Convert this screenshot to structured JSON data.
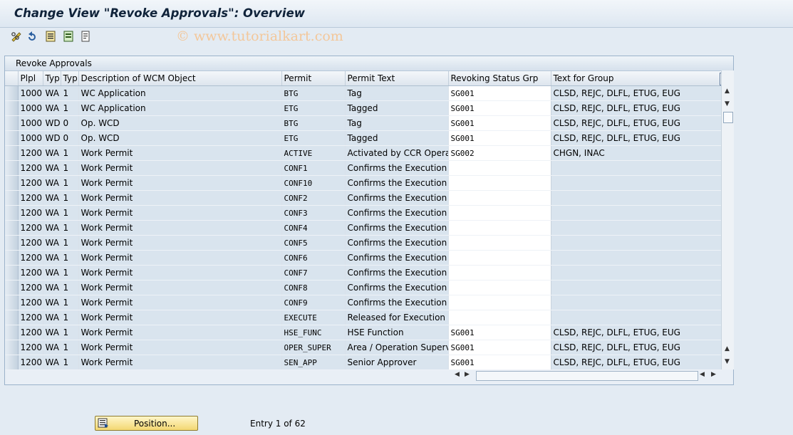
{
  "window": {
    "title": "Change View \"Revoke Approvals\": Overview"
  },
  "toolbar": {
    "icons": [
      "glasses-edit-icon",
      "undo-icon",
      "save-icon",
      "select-all-icon",
      "details-icon"
    ]
  },
  "watermark": "© www.tutorialkart.com",
  "panel": {
    "title": "Revoke Approvals"
  },
  "table": {
    "columns": [
      "Plpl",
      "Typ",
      "Typ",
      "Description of WCM Object",
      "Permit",
      "Permit Text",
      "Revoking Status Grp",
      "Text for Group"
    ],
    "rows": [
      [
        "1000",
        "WA",
        "1",
        "WC Application",
        "BTG",
        "Tag",
        "SG001",
        "CLSD, REJC, DLFL, ETUG, EUG"
      ],
      [
        "1000",
        "WA",
        "1",
        "WC Application",
        "ETG",
        "Tagged",
        "SG001",
        "CLSD, REJC, DLFL, ETUG, EUG"
      ],
      [
        "1000",
        "WD",
        "0",
        "Op. WCD",
        "BTG",
        "Tag",
        "SG001",
        "CLSD, REJC, DLFL, ETUG, EUG"
      ],
      [
        "1000",
        "WD",
        "0",
        "Op. WCD",
        "ETG",
        "Tagged",
        "SG001",
        "CLSD, REJC, DLFL, ETUG, EUG"
      ],
      [
        "1200",
        "WA",
        "1",
        "Work Permit",
        "ACTIVE",
        "Activated by CCR Operat...",
        "SG002",
        "CHGN, INAC"
      ],
      [
        "1200",
        "WA",
        "1",
        "Work Permit",
        "CONF1",
        "Confirms the Execution",
        "",
        ""
      ],
      [
        "1200",
        "WA",
        "1",
        "Work Permit",
        "CONF10",
        "Confirms the Execution",
        "",
        ""
      ],
      [
        "1200",
        "WA",
        "1",
        "Work Permit",
        "CONF2",
        "Confirms the Execution",
        "",
        ""
      ],
      [
        "1200",
        "WA",
        "1",
        "Work Permit",
        "CONF3",
        "Confirms the Execution",
        "",
        ""
      ],
      [
        "1200",
        "WA",
        "1",
        "Work Permit",
        "CONF4",
        "Confirms the Execution",
        "",
        ""
      ],
      [
        "1200",
        "WA",
        "1",
        "Work Permit",
        "CONF5",
        "Confirms the Execution",
        "",
        ""
      ],
      [
        "1200",
        "WA",
        "1",
        "Work Permit",
        "CONF6",
        "Confirms the Execution",
        "",
        ""
      ],
      [
        "1200",
        "WA",
        "1",
        "Work Permit",
        "CONF7",
        "Confirms the Execution",
        "",
        ""
      ],
      [
        "1200",
        "WA",
        "1",
        "Work Permit",
        "CONF8",
        "Confirms the Execution",
        "",
        ""
      ],
      [
        "1200",
        "WA",
        "1",
        "Work Permit",
        "CONF9",
        "Confirms the Execution",
        "",
        ""
      ],
      [
        "1200",
        "WA",
        "1",
        "Work Permit",
        "EXECUTE",
        "Released for Execution",
        "",
        ""
      ],
      [
        "1200",
        "WA",
        "1",
        "Work Permit",
        "HSE_FUNC",
        "HSE Function",
        "SG001",
        "CLSD, REJC, DLFL, ETUG, EUG"
      ],
      [
        "1200",
        "WA",
        "1",
        "Work Permit",
        "OPER_SUPER",
        "Area / Operation Supervi...",
        "SG001",
        "CLSD, REJC, DLFL, ETUG, EUG"
      ],
      [
        "1200",
        "WA",
        "1",
        "Work Permit",
        "SEN_APP",
        "Senior Approver",
        "SG001",
        "CLSD, REJC, DLFL, ETUG, EUG"
      ]
    ]
  },
  "footer": {
    "position_button_label": "Position...",
    "entry_info": "Entry 1 of 62"
  },
  "colors": {
    "row_bg": "#d9e4ee",
    "edit_bg": "#ffffff",
    "button_accent": "#f3d772",
    "title_color": "#10233a"
  }
}
